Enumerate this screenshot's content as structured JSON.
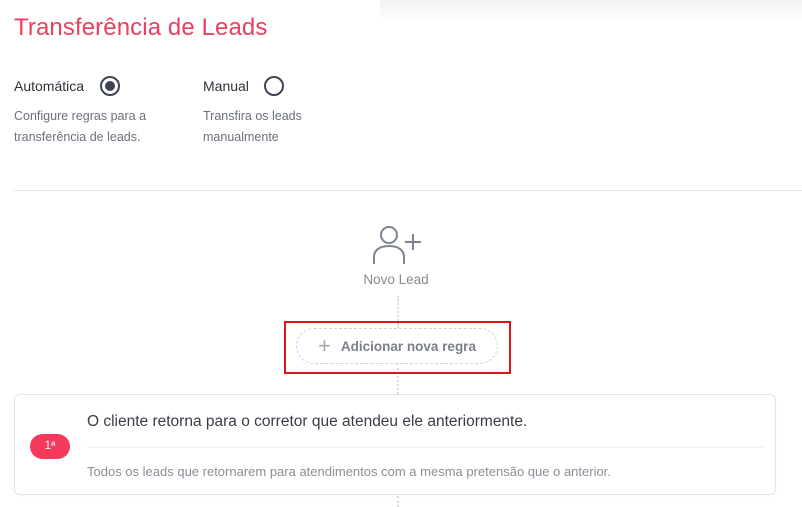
{
  "page": {
    "title": "Transferência de Leads"
  },
  "modes": [
    {
      "label": "Automática",
      "description": "Configure regras para a transferência de leads.",
      "selected": true
    },
    {
      "label": "Manual",
      "description": "Transfira os leads manualmente",
      "selected": false
    }
  ],
  "flow": {
    "start_label": "Novo Lead",
    "start_icon": "add-user-icon",
    "add_rule_label": "Adicionar nova regra",
    "add_rule_icon": "plus-icon"
  },
  "rules": [
    {
      "order_badge": "1ª",
      "title": "O cliente retorna para o corretor que atendeu ele anteriormente.",
      "description": "Todos os leads que retornarem para atendimentos com a mesma pretensão que o anterior."
    }
  ],
  "colors": {
    "title": "#ea3f5f",
    "badge": "#f4395d",
    "highlight_border": "#e0121b",
    "radio": "#3e4453"
  }
}
